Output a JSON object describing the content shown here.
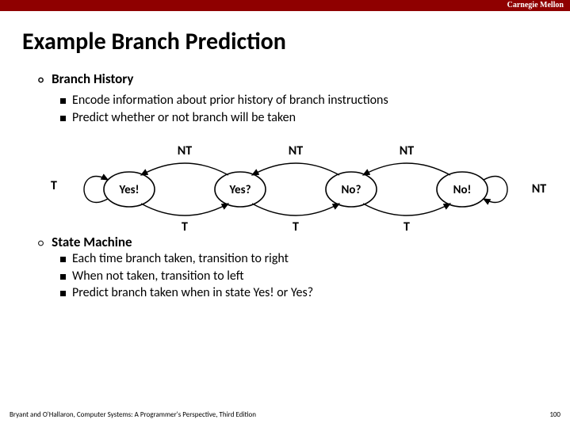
{
  "header": {
    "brand": "Carnegie Mellon"
  },
  "title": "Example Branch Prediction",
  "section1": {
    "heading": "Branch History",
    "items": [
      "Encode information about prior history of branch instructions",
      "Predict whether or not branch will be taken"
    ]
  },
  "diagram": {
    "nt": "NT",
    "t": "T",
    "states": [
      "Yes!",
      "Yes?",
      "No?",
      "No!"
    ]
  },
  "section2": {
    "heading": "State Machine",
    "items": [
      "Each time branch taken, transition to right",
      "When not taken, transition to left",
      "Predict branch taken when in state Yes! or Yes?"
    ]
  },
  "footer": {
    "credit": "Bryant and O'Hallaron, Computer Systems: A Programmer's Perspective, Third Edition",
    "page": "100"
  }
}
